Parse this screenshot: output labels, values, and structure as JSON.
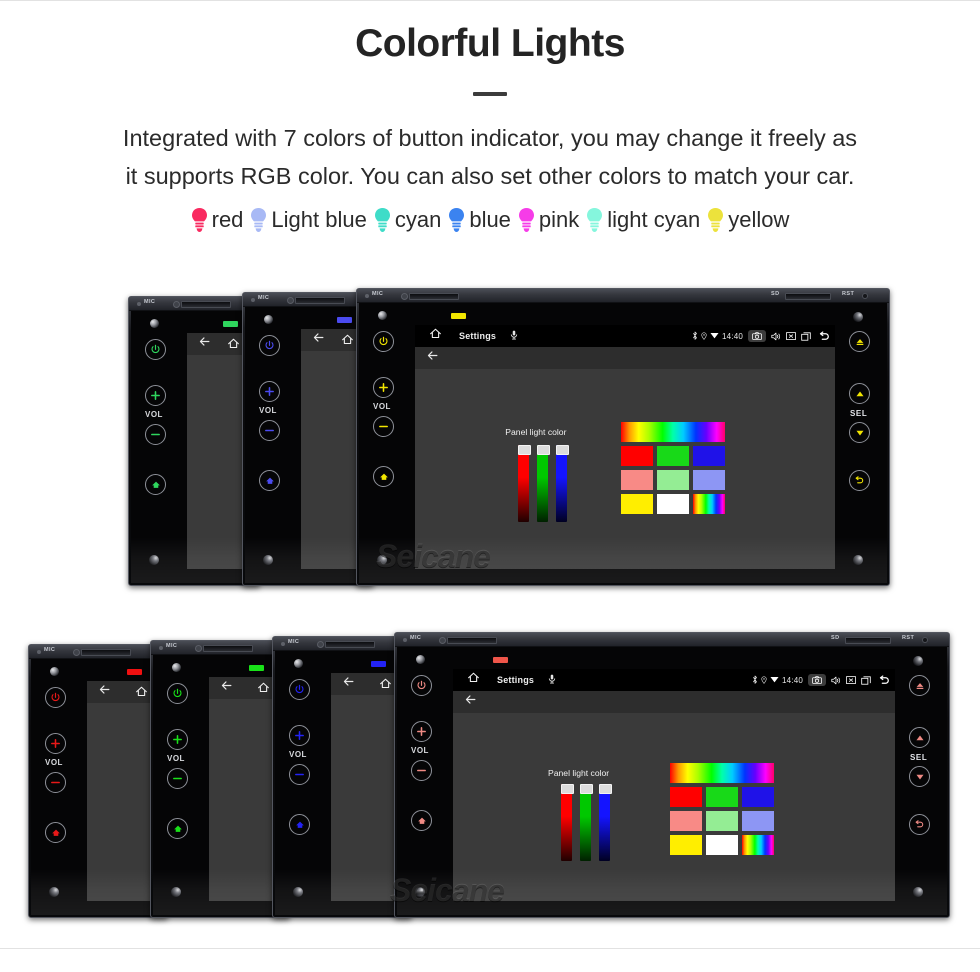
{
  "header": {
    "title": "Colorful Lights",
    "subtitle_line1": "Integrated with 7 colors of button indicator, you may change it freely as",
    "subtitle_line2": "it supports RGB color. You can also set other colors to match your car."
  },
  "legend": {
    "items": [
      {
        "label": "red",
        "color": "#f92a60",
        "icon": "bulb-icon"
      },
      {
        "label": "Light blue",
        "color": "#a8b9f5",
        "icon": "bulb-icon"
      },
      {
        "label": "cyan",
        "color": "#3fdcc8",
        "icon": "bulb-icon"
      },
      {
        "label": "blue",
        "color": "#3b83f0",
        "icon": "bulb-icon"
      },
      {
        "label": "pink",
        "color": "#f63ce8",
        "icon": "bulb-icon"
      },
      {
        "label": "light cyan",
        "color": "#85f6dd",
        "icon": "bulb-icon"
      },
      {
        "label": "yellow",
        "color": "#ece23c",
        "icon": "bulb-icon"
      }
    ]
  },
  "device": {
    "bezel": {
      "mic_label": "MIC",
      "sd_label": "SD",
      "rst_label": "RST"
    },
    "left_controls": {
      "power_label": "power-button",
      "vol_up_label": "+",
      "vol_label": "VOL",
      "vol_down_label": "−",
      "nav_label": "nav-button"
    },
    "right_controls": {
      "eject_label": "eject-button",
      "up_label": "up-button",
      "sel_label": "SEL",
      "down_label": "down-button",
      "back_label": "back-button"
    },
    "screen": {
      "nav_title": "Settings",
      "clock": "14:40",
      "status_icons": [
        "bluetooth-icon",
        "location-icon",
        "wifi-icon"
      ],
      "system_icons": [
        "camera-icon",
        "volume-icon",
        "close-icon",
        "recents-icon",
        "back-icon"
      ],
      "panel_light_label": "Panel light color",
      "sliders": [
        {
          "name": "red-slider",
          "color": "#ff0000",
          "value": 100
        },
        {
          "name": "green-slider",
          "color": "#00c800",
          "value": 100
        },
        {
          "name": "blue-slider",
          "color": "#1414ff",
          "value": 100
        }
      ],
      "swatches": {
        "spectrum_label": "spectrum-swatch",
        "rows": [
          [
            "#ff0000",
            "#18d918",
            "#1f12e8"
          ],
          [
            "#f88a86",
            "#94ed94",
            "#8d96f4"
          ],
          [
            "#ffee00",
            "#ffffff",
            "spectrum"
          ]
        ]
      }
    }
  },
  "watermark": {
    "text": "Seicane"
  },
  "panels": {
    "top": {
      "units": [
        {
          "name": "device-green",
          "led": "#2fd65e",
          "accent": "#2fd65e"
        },
        {
          "name": "device-blue",
          "led": "#4b4bf0",
          "accent": "#4b4bf0"
        },
        {
          "name": "device-yellow",
          "led": "#f2e600",
          "accent": "#f2e600"
        }
      ]
    },
    "bottom": {
      "units": [
        {
          "name": "device-red",
          "led": "#f01010",
          "accent": "#e81818"
        },
        {
          "name": "device-green",
          "led": "#19e219",
          "accent": "#19e219"
        },
        {
          "name": "device-blue",
          "led": "#2323f5",
          "accent": "#2323f5"
        },
        {
          "name": "device-salmon",
          "led": "#f0564a",
          "accent": "#ef8a84"
        }
      ]
    }
  }
}
